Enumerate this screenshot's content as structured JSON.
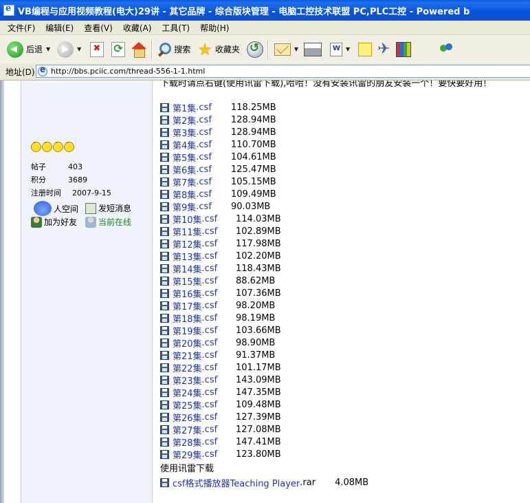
{
  "window": {
    "title": "VB编程与应用视频教程(电大)29讲 - 其它品牌 - 综合版块管理 - 电脑工控技术联盟 PC,PLC工控 - Powered b"
  },
  "menu": [
    "文件(F)",
    "编辑(E)",
    "查看(V)",
    "收藏(A)",
    "工具(T)",
    "帮助(H)"
  ],
  "toolbar": {
    "back_label": "后退",
    "search_label": "搜索",
    "favorites_label": "收藏夹"
  },
  "address": {
    "label": "地址(D)",
    "url": "http://bbs.pciic.com/thread-556-1-1.html"
  },
  "sidebar": {
    "stats": [
      {
        "label": "帖子",
        "value": "403"
      },
      {
        "label": "积分",
        "value": "3689"
      },
      {
        "label": "注册时间",
        "value": "2007-9-15"
      }
    ],
    "actions": {
      "space": "人空间",
      "message": "发短消息",
      "add_friend": "加为好友",
      "online": "当前在线"
    }
  },
  "post": {
    "notice": "下载时请点右键(使用讯雷下载),哈哈！没有安装讯雷的朋友安装一个！要快要好用！",
    "files": [
      {
        "name": "第1集",
        "ext": ".csf",
        "size": "118.25MB"
      },
      {
        "name": "第2集",
        "ext": ".csf",
        "size": "128.94MB"
      },
      {
        "name": "第3集",
        "ext": ".csf",
        "size": "128.94MB"
      },
      {
        "name": "第4集",
        "ext": ".csf",
        "size": "110.70MB"
      },
      {
        "name": "第5集",
        "ext": ".csf",
        "size": "104.61MB"
      },
      {
        "name": "第6集",
        "ext": ".csf",
        "size": "125.47MB"
      },
      {
        "name": "第7集",
        "ext": ".csf",
        "size": "105.15MB"
      },
      {
        "name": "第8集",
        "ext": ".csf",
        "size": "109.49MB"
      },
      {
        "name": "第9集",
        "ext": ".csf",
        "size": "90.03MB"
      },
      {
        "name": "第10集",
        "ext": ".csf",
        "size": "114.03MB"
      },
      {
        "name": "第11集",
        "ext": ".csf",
        "size": "102.89MB"
      },
      {
        "name": "第12集",
        "ext": ".csf",
        "size": "117.98MB"
      },
      {
        "name": "第13集",
        "ext": ".csf",
        "size": "102.20MB"
      },
      {
        "name": "第14集",
        "ext": ".csf",
        "size": "118.43MB"
      },
      {
        "name": "第15集",
        "ext": ".csf",
        "size": "88.62MB"
      },
      {
        "name": "第16集",
        "ext": ".csf",
        "size": "107.36MB"
      },
      {
        "name": "第17集",
        "ext": ".csf",
        "size": "98.20MB"
      },
      {
        "name": "第18集",
        "ext": ".csf",
        "size": "98.19MB"
      },
      {
        "name": "第19集",
        "ext": ".csf",
        "size": "103.66MB"
      },
      {
        "name": "第20集",
        "ext": ".csf",
        "size": "98.90MB"
      },
      {
        "name": "第21集",
        "ext": ".csf",
        "size": "91.37MB"
      },
      {
        "name": "第22集",
        "ext": ".csf",
        "size": "101.17MB"
      },
      {
        "name": "第23集",
        "ext": ".csf",
        "size": "143.09MB"
      },
      {
        "name": "第24集",
        "ext": ".csf",
        "size": "147.35MB"
      },
      {
        "name": "第25集",
        "ext": ".csf",
        "size": "109.48MB"
      },
      {
        "name": "第26集",
        "ext": ".csf",
        "size": "127.39MB"
      },
      {
        "name": "第27集",
        "ext": ".csf",
        "size": "127.08MB"
      },
      {
        "name": "第28集",
        "ext": ".csf",
        "size": "147.41MB"
      },
      {
        "name": "第29集",
        "ext": ".csf",
        "size": "123.80MB"
      }
    ],
    "thunder_text": "使用讯雷下载",
    "player": {
      "name": "csf格式播放器Teaching Player",
      "ext": ".rar",
      "size": "4.08MB"
    }
  }
}
